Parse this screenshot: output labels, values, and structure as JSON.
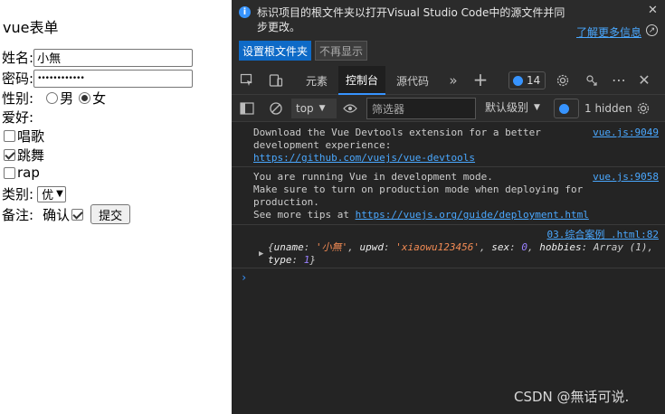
{
  "form": {
    "title": "vue表单",
    "name_label": "姓名:",
    "name_value": "小無",
    "password_label": "密码:",
    "password_value": "••••••••••••",
    "gender_label": "性别:",
    "gender_options": [
      "男",
      "女"
    ],
    "gender_selected": "女",
    "hobbies_label": "爱好:",
    "hobbies": [
      {
        "label": "唱歌",
        "checked": false
      },
      {
        "label": "跳舞",
        "checked": true
      },
      {
        "label": "rap",
        "checked": false
      }
    ],
    "category_label": "类别:",
    "category_value": "优",
    "remark_label": "备注:",
    "confirm_label": "确认",
    "confirm_checked": true,
    "submit_label": "提交"
  },
  "devtools": {
    "banner": {
      "message": "标识项目的根文件夹以打开Visual Studio Code中的源文件并同步更改。",
      "learn_more": "了解更多信息",
      "set_root_button": "设置根文件夹",
      "dont_show_button": "不再显示"
    },
    "tabs": {
      "elements": "元素",
      "console": "控制台",
      "sources": "源代码",
      "message_count": "14"
    },
    "toolbar": {
      "context": "top",
      "filter_placeholder": "筛选器",
      "levels": "默认级别",
      "hidden": "1 hidden"
    },
    "console": {
      "messages": [
        {
          "line1": "Download the Vue Devtools extension for a better",
          "line2": "development experience:",
          "link": "https://github.com/vuejs/vue-devtools",
          "source": "vue.js:9049"
        },
        {
          "line1": "You are running Vue in development mode.",
          "line2": "Make sure to turn on production mode when deploying for",
          "line3": "production.",
          "line4_prefix": "See more tips at ",
          "link": "https://vuejs.org/guide/deployment.html",
          "source": "vue.js:9058"
        },
        {
          "source": "03.综合案例 .html:82",
          "k_uname": "uname",
          "v_uname": "'小無'",
          "k_upwd": "upwd",
          "v_upwd": "'xiaowu123456'",
          "k_sex": "sex",
          "v_sex": "0",
          "k_hobbies": "hobbies",
          "v_hobbies": "Array",
          "v_hobbies_len": "(1)",
          "k_type": "type",
          "v_type": "1"
        }
      ]
    },
    "watermark": "CSDN @無话可说."
  },
  "colors": {
    "devtools_bg": "#242424",
    "accent": "#3794ff",
    "link": "#4aa8ff",
    "string": "#f28b54",
    "number": "#9980ff"
  }
}
